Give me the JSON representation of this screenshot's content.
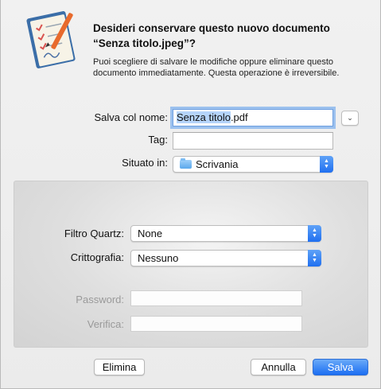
{
  "dialog": {
    "title": "Desideri conservare questo nuovo documento “Senza titolo.jpeg”?",
    "message": "Puoi scegliere di salvare le modifiche oppure eliminare questo documento immediatamente. Questa operazione è irreversibile."
  },
  "form": {
    "save_as_label": "Salva col nome:",
    "save_as_selected": "Senza titolo",
    "save_as_extension": ".pdf",
    "tags_label": "Tag:",
    "tags_value": "",
    "location_label": "Situato in:",
    "location_value": "Scrivania",
    "location_icon": "folder-icon"
  },
  "options": {
    "quartz_filter_label": "Filtro Quartz:",
    "quartz_filter_value": "None",
    "encryption_label": "Crittografia:",
    "encryption_value": "Nessuno",
    "password_label": "Password:",
    "password_value": "",
    "verify_label": "Verifica:",
    "verify_value": ""
  },
  "buttons": {
    "delete": "Elimina",
    "cancel": "Annulla",
    "save": "Salva"
  },
  "colors": {
    "accent": "#1c6ef2",
    "selection": "#b5d4fa",
    "focus_ring": "#9cc1ee"
  }
}
